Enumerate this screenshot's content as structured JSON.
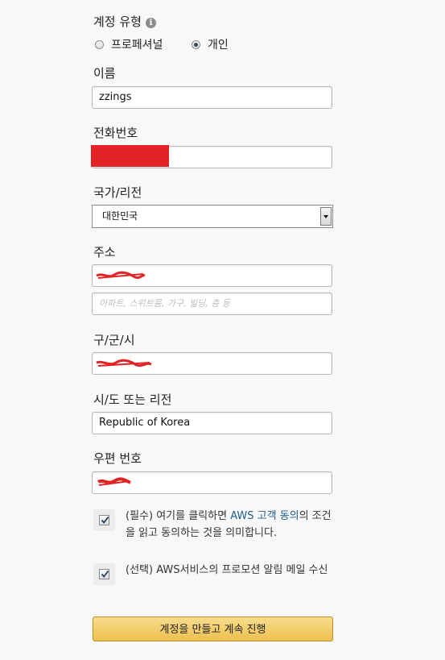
{
  "account_type": {
    "label": "계정 유형",
    "info_glyph": "i",
    "options": [
      {
        "label": "프로페셔널",
        "checked": false
      },
      {
        "label": "개인",
        "checked": true
      }
    ]
  },
  "name": {
    "label": "이름",
    "value": "zzings"
  },
  "phone": {
    "label": "전화번호",
    "value": "",
    "redacted": true
  },
  "country": {
    "label": "국가/리전",
    "selected": "대한민국"
  },
  "address": {
    "label": "주소",
    "line1_value": "",
    "line1_redacted": true,
    "line2_placeholder": "아파트, 스위트룸, 가구, 빌딩, 층 등"
  },
  "city": {
    "label": "구/군/시",
    "value": "",
    "redacted": true
  },
  "state": {
    "label": "시/도 또는 리전",
    "value": "Republic of Korea"
  },
  "postal": {
    "label": "우편 번호",
    "value": "",
    "redacted": true
  },
  "agreement": {
    "checked": true,
    "text_before": "(필수) 여기를 클릭하면 ",
    "link_text": "AWS 고객 동의",
    "text_after": "의 조건을 읽고 동의하는 것을 의미합니다."
  },
  "promotions": {
    "checked": true,
    "text": "(선택) AWS서비스의 프로모션 알림 메일 수신"
  },
  "submit": {
    "label": "계정을 만들고 계속 진행"
  },
  "colors": {
    "redaction": "#e32326",
    "link": "#1a5c8c",
    "button_top": "#f8dc8d",
    "button_bottom": "#eec04e"
  }
}
